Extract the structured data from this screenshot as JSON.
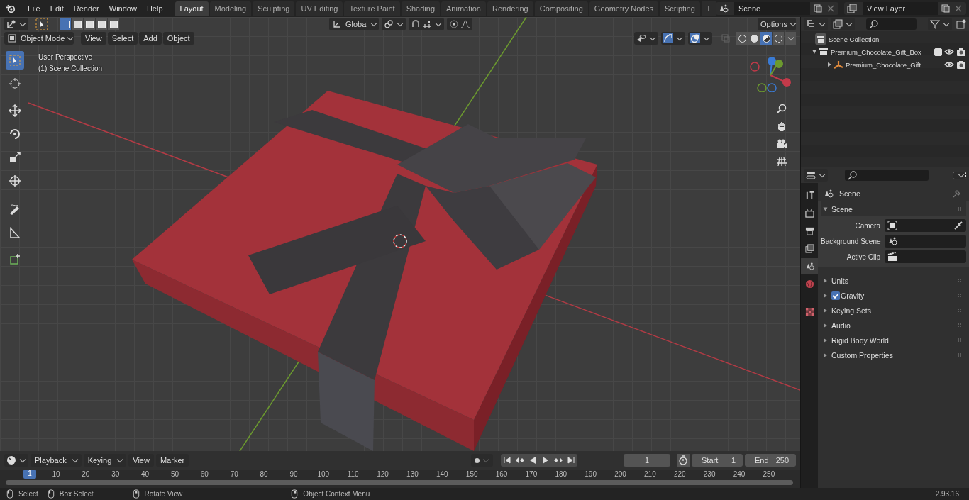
{
  "menu_bar": {
    "items": [
      "File",
      "Edit",
      "Render",
      "Window",
      "Help"
    ]
  },
  "workspace_tabs": [
    {
      "label": "Layout",
      "selected": true
    },
    {
      "label": "Modeling",
      "selected": false
    },
    {
      "label": "Sculpting",
      "selected": false
    },
    {
      "label": "UV Editing",
      "selected": false
    },
    {
      "label": "Texture Paint",
      "selected": false
    },
    {
      "label": "Shading",
      "selected": false
    },
    {
      "label": "Animation",
      "selected": false
    },
    {
      "label": "Rendering",
      "selected": false
    },
    {
      "label": "Compositing",
      "selected": false
    },
    {
      "label": "Geometry Nodes",
      "selected": false
    },
    {
      "label": "Scripting",
      "selected": false
    }
  ],
  "add_tab_button": "+",
  "scene_selector": {
    "value": "Scene"
  },
  "view_layer_selector": {
    "value": "View Layer"
  },
  "viewport": {
    "select_modes": [
      {
        "selected": true
      },
      {
        "selected": false
      },
      {
        "selected": false
      },
      {
        "selected": false
      },
      {
        "selected": false
      }
    ],
    "transform_orientation": "Global",
    "options": "Options",
    "mode": "Object Mode",
    "menus": [
      "View",
      "Select",
      "Add",
      "Object"
    ],
    "shading_modes": [
      {
        "selected": false
      },
      {
        "selected": false
      },
      {
        "selected": true
      },
      {
        "selected": false
      }
    ],
    "overlay_text": [
      "User Perspective",
      "(1) Scene Collection"
    ],
    "tools": [
      {
        "selected": true
      },
      {
        "selected": false
      },
      {
        "selected": false
      },
      {
        "selected": false
      },
      {
        "selected": false
      },
      {
        "selected": false
      },
      {
        "selected": false
      },
      {
        "selected": false
      },
      {
        "selected": false
      }
    ]
  },
  "outliner": {
    "root": "Scene Collection",
    "items": [
      {
        "name": "Premium_Chocolate_Gift_Box",
        "expanded": true,
        "checked": true,
        "children": [
          {
            "name": "Premium_Chocolate_Gift",
            "expanded": false
          }
        ]
      }
    ]
  },
  "properties": {
    "context": "Scene",
    "tabs": [
      {
        "selected": false
      },
      {
        "selected": false
      },
      {
        "selected": false
      },
      {
        "selected": false
      },
      {
        "selected": true
      },
      {
        "selected": false
      },
      {
        "selected": false
      }
    ],
    "panels": [
      {
        "title": "Scene",
        "kind": "plain",
        "expanded": true,
        "fields": [
          {
            "label": "Camera",
            "kind": "camera"
          },
          {
            "label": "Background Scene",
            "kind": "scene"
          },
          {
            "label": "Active Clip",
            "kind": "clip"
          }
        ]
      },
      {
        "title": "Units",
        "kind": "plain",
        "expanded": false
      },
      {
        "title": "Gravity",
        "kind": "checkbox",
        "expanded": false,
        "checked": true
      },
      {
        "title": "Keying Sets",
        "kind": "plain",
        "expanded": false
      },
      {
        "title": "Audio",
        "kind": "plain",
        "expanded": false
      },
      {
        "title": "Rigid Body World",
        "kind": "plain",
        "expanded": false
      },
      {
        "title": "Custom Properties",
        "kind": "plain",
        "expanded": false
      }
    ]
  },
  "timeline": {
    "menus": [
      "Playback",
      "Keying",
      "View",
      "Marker"
    ],
    "current_frame": "1",
    "start_label": "Start",
    "start": "1",
    "end_label": "End",
    "end": "250",
    "playhead": "1",
    "ruler_ticks": [
      "10",
      "20",
      "30",
      "40",
      "50",
      "60",
      "70",
      "80",
      "90",
      "100",
      "110",
      "120",
      "130",
      "140",
      "150",
      "160",
      "170",
      "180",
      "190",
      "200",
      "210",
      "220",
      "230",
      "240",
      "250"
    ]
  },
  "status_bar": {
    "hints": [
      "Select",
      "Box Select",
      "Rotate View",
      "Object Context Menu"
    ],
    "version": "2.93.16"
  }
}
